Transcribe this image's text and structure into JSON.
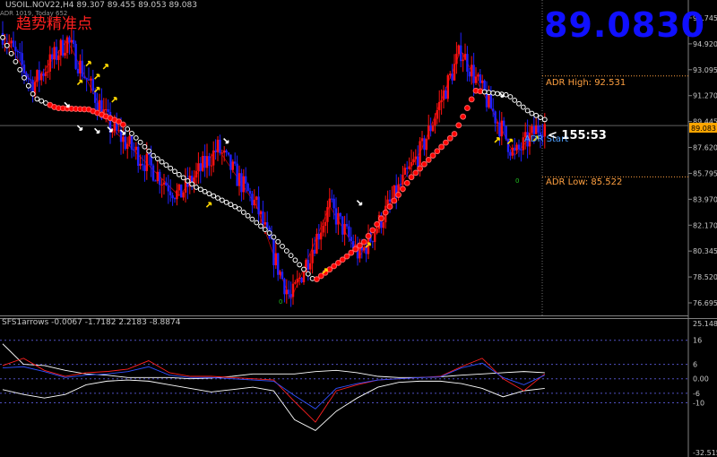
{
  "window": {
    "symbol_info": "USOIL.NOV22,H4  89.307 89.455 89.053 89.083",
    "adr_info": "ADR 1019, Today 652",
    "chinese_title": "趋势精准点",
    "big_price": "89.0830",
    "adr_high_label": "ADR High: 92.531",
    "adr_low_label": "ADR Low: 85.522",
    "adr_start_label": "ADR Start",
    "countdown": "< 155:53",
    "indicator_label": "SFS1arrows -0.0067 -1.7182 2.2183 -8.8874",
    "zero_marks": [
      "0",
      "0"
    ]
  },
  "colors": {
    "background": "#000000",
    "bull_bar": "#ff1010",
    "bear_bar": "#2020ff",
    "trend_white": "#ffffff",
    "trend_red": "#ff0000",
    "arrow_yellow": "#ffd700",
    "arrow_white": "#ffffff",
    "adr_lines": "#ffa040",
    "axis_text": "#c8c8c8",
    "current_price_tag": "#ffa500"
  },
  "chart_data": [
    {
      "type": "candlestick",
      "title": "USOIL.NOV22,H4",
      "ylim": [
        75.9,
        97.8
      ],
      "y_ticks": [
        "96.745",
        "94.920",
        "93.095",
        "91.270",
        "89.445",
        "87.620",
        "85.795",
        "83.970",
        "82.170",
        "80.345",
        "78.520",
        "76.695"
      ],
      "current_price": "89.083",
      "adr_high": 92.531,
      "adr_low": 85.522,
      "major_swings": [
        {
          "index": 0,
          "price": 95.5
        },
        {
          "index": 14,
          "price": 91.9
        },
        {
          "index": 30,
          "price": 95.0
        },
        {
          "index": 50,
          "price": 89.0
        },
        {
          "index": 82,
          "price": 84.2
        },
        {
          "index": 100,
          "price": 87.5
        },
        {
          "index": 118,
          "price": 83.5
        },
        {
          "index": 128,
          "price": 79.2
        },
        {
          "index": 134,
          "price": 77.0
        },
        {
          "index": 152,
          "price": 83.5
        },
        {
          "index": 166,
          "price": 80.0
        },
        {
          "index": 195,
          "price": 87.5
        },
        {
          "index": 213,
          "price": 94.3
        },
        {
          "index": 228,
          "price": 90.0
        },
        {
          "index": 238,
          "price": 87.0
        },
        {
          "index": 250,
          "price": 89.1
        }
      ],
      "trend_line": [
        {
          "index": 0,
          "price": 95.2
        },
        {
          "index": 15,
          "price": 91.0
        },
        {
          "index": 25,
          "price": 90.3
        },
        {
          "index": 40,
          "price": 90.2
        },
        {
          "index": 55,
          "price": 89.3
        },
        {
          "index": 70,
          "price": 87.0
        },
        {
          "index": 90,
          "price": 84.8
        },
        {
          "index": 110,
          "price": 83.3
        },
        {
          "index": 125,
          "price": 81.5
        },
        {
          "index": 145,
          "price": 78.3
        },
        {
          "index": 160,
          "price": 80.0
        },
        {
          "index": 168,
          "price": 81.0
        },
        {
          "index": 190,
          "price": 85.5
        },
        {
          "index": 210,
          "price": 88.5
        },
        {
          "index": 220,
          "price": 91.5
        },
        {
          "index": 235,
          "price": 91.2
        },
        {
          "index": 245,
          "price": 90.0
        },
        {
          "index": 252,
          "price": 89.5
        }
      ],
      "trend_red_segments": [
        [
          22,
          56
        ],
        [
          145,
          222
        ]
      ],
      "arrows": [
        {
          "index": 30,
          "price": 90.5,
          "dir": "down",
          "color": "white"
        },
        {
          "index": 36,
          "price": 88.9,
          "dir": "down",
          "color": "white"
        },
        {
          "index": 44,
          "price": 88.7,
          "dir": "down",
          "color": "white"
        },
        {
          "index": 50,
          "price": 88.8,
          "dir": "down",
          "color": "white"
        },
        {
          "index": 56,
          "price": 88.6,
          "dir": "down",
          "color": "white"
        },
        {
          "index": 104,
          "price": 88.0,
          "dir": "down",
          "color": "white"
        },
        {
          "index": 166,
          "price": 83.7,
          "dir": "down",
          "color": "white"
        },
        {
          "index": 232,
          "price": 91.2,
          "dir": "down",
          "color": "white"
        },
        {
          "index": 40,
          "price": 93.4,
          "dir": "up",
          "color": "yellow"
        },
        {
          "index": 44,
          "price": 92.5,
          "dir": "up",
          "color": "yellow"
        },
        {
          "index": 48,
          "price": 93.2,
          "dir": "up",
          "color": "yellow"
        },
        {
          "index": 36,
          "price": 92.1,
          "dir": "up",
          "color": "yellow"
        },
        {
          "index": 52,
          "price": 90.9,
          "dir": "up",
          "color": "yellow"
        },
        {
          "index": 44,
          "price": 91.6,
          "dir": "up",
          "color": "yellow"
        },
        {
          "index": 96,
          "price": 83.6,
          "dir": "up",
          "color": "yellow"
        },
        {
          "index": 150,
          "price": 79.0,
          "dir": "up",
          "color": "yellow"
        },
        {
          "index": 170,
          "price": 80.8,
          "dir": "up",
          "color": "yellow"
        },
        {
          "index": 230,
          "price": 88.1,
          "dir": "up",
          "color": "yellow"
        },
        {
          "index": 236,
          "price": 88.0,
          "dir": "up",
          "color": "yellow"
        },
        {
          "index": 248,
          "price": 88.2,
          "dir": "up",
          "color": "yellow"
        }
      ]
    },
    {
      "type": "line",
      "title": "SFS1arrows",
      "ylim": [
        -32.5,
        25.2
      ],
      "y_ticks": [
        "25.1483",
        "16",
        "6",
        "0.00",
        "-6",
        "-10",
        "-32.515"
      ],
      "levels": [
        16,
        6,
        0,
        -6,
        -10
      ],
      "series": [
        {
          "color": "#ffffff",
          "values": [
            14.5,
            6,
            5.5,
            3.5,
            2.0,
            1.5,
            0.5,
            0.5,
            0.5,
            0.0,
            0.3,
            1.0,
            2.0,
            2.0,
            2.0,
            3.0,
            3.5,
            2.5,
            1.0,
            0.5,
            0.5,
            0.8,
            1.5,
            2.0,
            2.5,
            3.0,
            2.5
          ]
        },
        {
          "color": "#ffffff",
          "values": [
            -4.5,
            -6.5,
            -8.0,
            -6.5,
            -2.5,
            -1.0,
            -0.5,
            -1.0,
            -2.5,
            -4.0,
            -5.5,
            -4.5,
            -3.5,
            -5.0,
            -17.0,
            -21.5,
            -13.5,
            -8.0,
            -3.5,
            -1.5,
            -1.0,
            -1.0,
            -2.0,
            -4.0,
            -7.5,
            -5.0,
            -4.0
          ]
        },
        {
          "color": "#ff2020",
          "values": [
            5.5,
            8.5,
            3.5,
            1.0,
            2.5,
            3.0,
            4.0,
            7.5,
            2.5,
            1.0,
            1.0,
            0.5,
            0.0,
            -0.5,
            -9.5,
            -18.0,
            -5.0,
            -2.5,
            -0.5,
            0.0,
            0.5,
            1.0,
            5.0,
            8.5,
            0.0,
            -5.0,
            2.0
          ]
        },
        {
          "color": "#3050ff",
          "values": [
            4.5,
            5.0,
            3.0,
            0.5,
            1.5,
            2.0,
            3.0,
            5.0,
            1.5,
            0.5,
            0.5,
            0.0,
            -0.5,
            -1.0,
            -7.0,
            -12.5,
            -4.0,
            -2.0,
            -0.5,
            0.0,
            0.5,
            0.8,
            4.5,
            6.5,
            0.5,
            -2.5,
            1.5
          ]
        }
      ]
    }
  ]
}
